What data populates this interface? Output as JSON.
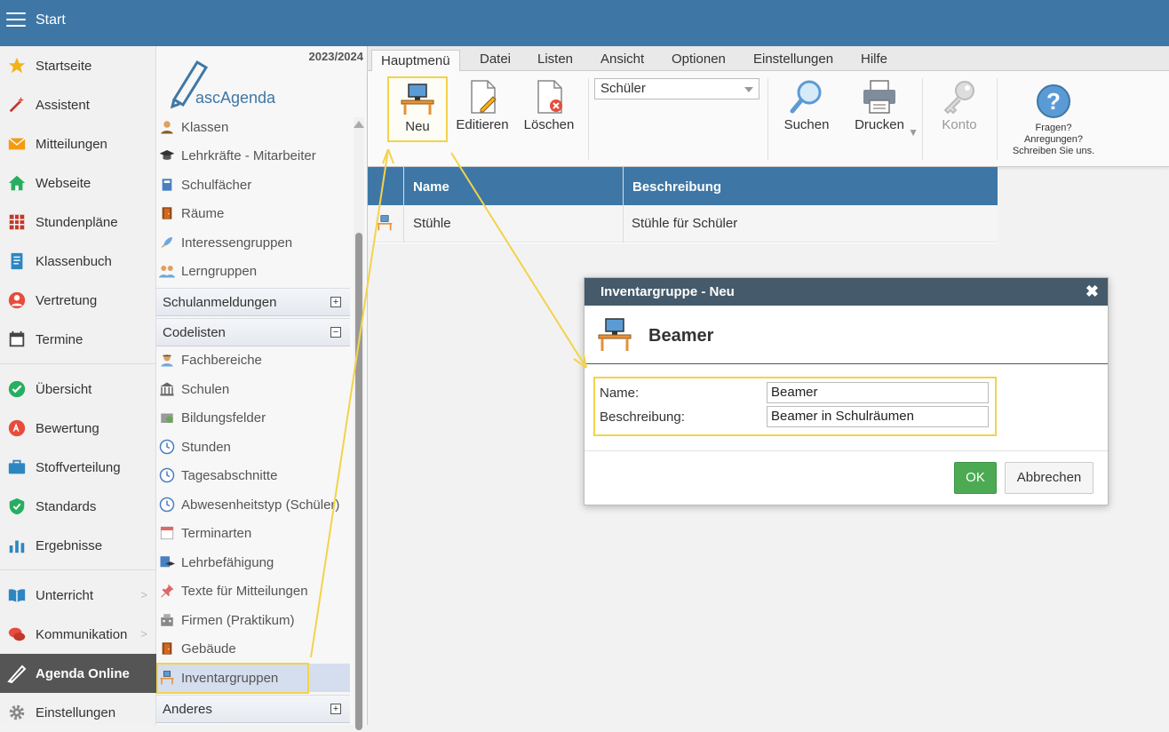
{
  "topbar": {
    "title": "Start"
  },
  "leftnav": {
    "items": [
      {
        "label": "Startseite",
        "icon": "star-icon"
      },
      {
        "label": "Assistent",
        "icon": "magic-wand-icon"
      },
      {
        "label": "Mitteilungen",
        "icon": "envelope-icon"
      },
      {
        "label": "Webseite",
        "icon": "house-icon"
      },
      {
        "label": "Stundenpläne",
        "icon": "timetable-icon"
      },
      {
        "label": "Klassenbuch",
        "icon": "class-book-icon"
      },
      {
        "label": "Vertretung",
        "icon": "substitute-icon"
      },
      {
        "label": "Termine",
        "icon": "calendar-icon"
      },
      {
        "label": "Übersicht",
        "icon": "check-circle-icon"
      },
      {
        "label": "Bewertung",
        "icon": "grade-icon"
      },
      {
        "label": "Stoffverteilung",
        "icon": "briefcase-icon"
      },
      {
        "label": "Standards",
        "icon": "shield-check-icon"
      },
      {
        "label": "Ergebnisse",
        "icon": "bar-chart-icon"
      },
      {
        "label": "Unterricht",
        "icon": "open-book-icon"
      },
      {
        "label": "Kommunikation",
        "icon": "chat-icon"
      },
      {
        "label": "Agenda Online",
        "icon": "pen-logo-icon"
      },
      {
        "label": "Einstellungen",
        "icon": "gear-icon"
      }
    ]
  },
  "tree": {
    "year": "2023/2024",
    "logo_text": "ascAgenda",
    "items_top": [
      {
        "label": "Klassen",
        "icon": "class-icon"
      },
      {
        "label": "Lehrkräfte - Mitarbeiter",
        "icon": "graduation-cap-icon"
      },
      {
        "label": "Schulfächer",
        "icon": "book-icon"
      },
      {
        "label": "Räume",
        "icon": "door-icon"
      },
      {
        "label": "Interessengruppen",
        "icon": "rocket-icon"
      },
      {
        "label": "Lerngruppen",
        "icon": "group-icon"
      }
    ],
    "sections": [
      {
        "label": "Schulanmeldungen",
        "toggle": "+"
      },
      {
        "label": "Codelisten",
        "toggle": "−"
      },
      {
        "label": "Anderes",
        "toggle": "+"
      }
    ],
    "items_codelisten": [
      {
        "label": "Fachbereiche",
        "icon": "department-icon"
      },
      {
        "label": "Schulen",
        "icon": "school-building-icon"
      },
      {
        "label": "Bildungsfelder",
        "icon": "education-field-icon"
      },
      {
        "label": "Stunden",
        "icon": "clock-icon"
      },
      {
        "label": "Tagesabschnitte",
        "icon": "clock-icon"
      },
      {
        "label": "Abwesenheitstyp (Schüler)",
        "icon": "clock-icon"
      },
      {
        "label": "Terminarten",
        "icon": "calendar-page-icon"
      },
      {
        "label": "Lehrbefähigung",
        "icon": "qualification-icon"
      },
      {
        "label": "Texte für Mitteilungen",
        "icon": "pin-icon"
      },
      {
        "label": "Firmen (Praktikum)",
        "icon": "company-icon"
      },
      {
        "label": "Gebäude",
        "icon": "door-icon"
      },
      {
        "label": "Inventargruppen",
        "icon": "desk-computer-icon"
      }
    ]
  },
  "menubar": {
    "tabs": [
      "Hauptmenü",
      "Datei",
      "Listen",
      "Ansicht",
      "Optionen",
      "Einstellungen",
      "Hilfe"
    ]
  },
  "toolbar": {
    "new_label": "Neu",
    "edit_label": "Editieren",
    "delete_label": "Löschen",
    "select_value": "Schüler",
    "search_label": "Suchen",
    "print_label": "Drucken",
    "account_label": "Konto",
    "help_line1": "Fragen?",
    "help_line2": "Anregungen?",
    "help_line3": "Schreiben Sie uns."
  },
  "grid": {
    "columns": [
      "Name",
      "Beschreibung"
    ],
    "rows": [
      {
        "name": "Stühle",
        "description": "Stühle für Schüler"
      }
    ]
  },
  "dialog": {
    "title": "Inventargruppe - Neu",
    "close_glyph": "✖",
    "heading": "Beamer",
    "name_label": "Name:",
    "name_value": "Beamer",
    "description_label": "Beschreibung:",
    "description_value": "Beamer in Schulräumen",
    "ok_label": "OK",
    "cancel_label": "Abbrechen"
  },
  "colors": {
    "header_blue": "#3e77a6",
    "dialog_header": "#455a6a",
    "highlight_yellow": "#f3d34a",
    "ok_green": "#4caa52"
  }
}
